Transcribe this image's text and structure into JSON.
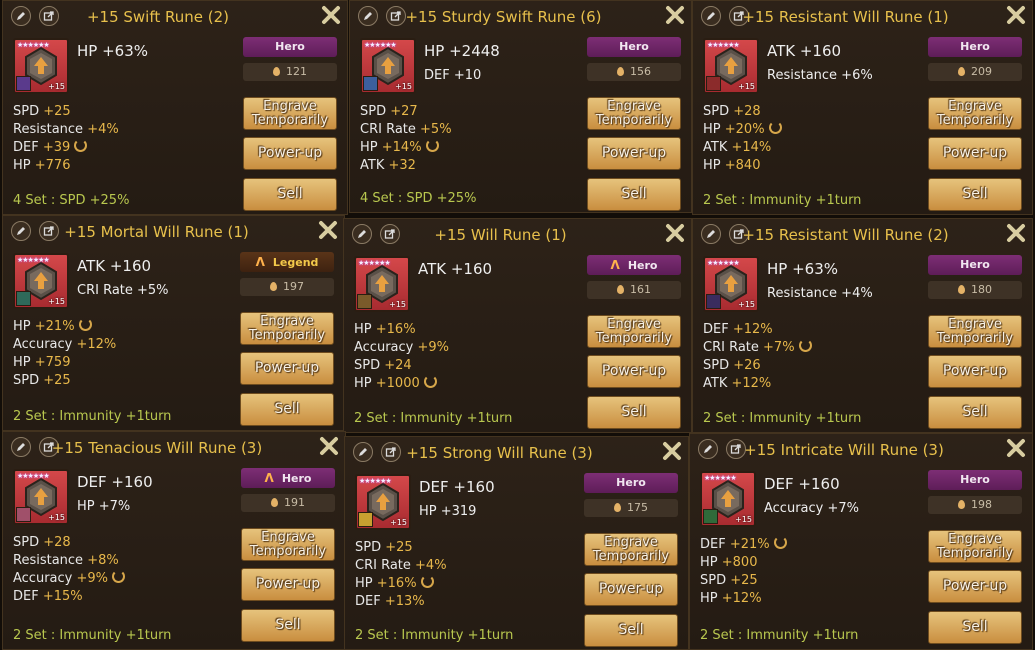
{
  "colors": {
    "accent": "#e7c04c",
    "hero": "#7d2e75",
    "legend": "#f2c94a",
    "set_text": "#b9c84f",
    "value": "#e8b84b"
  },
  "runes": [
    {
      "title": "+15 Swift Rune (2)",
      "stars": "★★★★★★",
      "level": "+15",
      "main": "HP +63%",
      "innate": "",
      "grade": "Hero",
      "grade_mark": "",
      "price": "121",
      "subs": [
        {
          "name": "SPD",
          "val": "+25",
          "grind": false
        },
        {
          "name": "Resistance",
          "val": "+4%",
          "grind": false
        },
        {
          "name": "DEF",
          "val": "+39",
          "grind": true
        },
        {
          "name": "HP",
          "val": "+776",
          "grind": false
        }
      ],
      "set": "4 Set : SPD +25%",
      "engrave": "Engrave Temporarily",
      "power": "Power-up",
      "sell": "Sell",
      "icon": "slot-2-rune-icon"
    },
    {
      "title": "+15 Sturdy Swift Rune (6)",
      "stars": "★★★★★★",
      "level": "+15",
      "main": "HP +2448",
      "innate": "DEF +10",
      "grade": "Hero",
      "grade_mark": "",
      "price": "156",
      "subs": [
        {
          "name": "SPD",
          "val": "+27",
          "grind": false
        },
        {
          "name": "CRI Rate",
          "val": "+5%",
          "grind": false
        },
        {
          "name": "HP",
          "val": "+14%",
          "grind": true
        },
        {
          "name": "ATK",
          "val": "+32",
          "grind": false
        }
      ],
      "set": "4 Set : SPD +25%",
      "engrave": "Engrave Temporarily",
      "power": "Power-up",
      "sell": "Sell",
      "icon": "slot-6-rune-icon"
    },
    {
      "title": "+15 Resistant Will Rune (1)",
      "stars": "★★★★★★",
      "level": "+15",
      "main": "ATK +160",
      "innate": "Resistance +6%",
      "grade": "Hero",
      "grade_mark": "",
      "price": "209",
      "subs": [
        {
          "name": "SPD",
          "val": "+28",
          "grind": false
        },
        {
          "name": "HP",
          "val": "+20%",
          "grind": true
        },
        {
          "name": "ATK",
          "val": "+14%",
          "grind": false
        },
        {
          "name": "HP",
          "val": "+840",
          "grind": false
        }
      ],
      "set": "2 Set : Immunity +1turn",
      "engrave": "Engrave Temporarily",
      "power": "Power-up",
      "sell": "Sell",
      "icon": "slot-1-rune-icon"
    },
    {
      "title": "+15 Mortal Will Rune (1)",
      "stars": "★★★★★★",
      "level": "+15",
      "main": "ATK +160",
      "innate": "CRI Rate +5%",
      "grade": "Legend",
      "grade_mark": "ᐱ",
      "price": "197",
      "subs": [
        {
          "name": "HP",
          "val": "+21%",
          "grind": true
        },
        {
          "name": "Accuracy",
          "val": "+12%",
          "grind": false
        },
        {
          "name": "HP",
          "val": "+759",
          "grind": false
        },
        {
          "name": "SPD",
          "val": "+25",
          "grind": false
        }
      ],
      "set": "2 Set : Immunity +1turn",
      "engrave": "Engrave Temporarily",
      "power": "Power-up",
      "sell": "Sell",
      "icon": "slot-1-rune-icon"
    },
    {
      "title": "+15 Will Rune (1)",
      "stars": "★★★★★★",
      "level": "+15",
      "main": "ATK +160",
      "innate": "",
      "grade": "Hero",
      "grade_mark": "ᐱ",
      "price": "161",
      "subs": [
        {
          "name": "HP",
          "val": "+16%",
          "grind": false
        },
        {
          "name": "Accuracy",
          "val": "+9%",
          "grind": false
        },
        {
          "name": "SPD",
          "val": "+24",
          "grind": false
        },
        {
          "name": "HP",
          "val": "+1000",
          "grind": true
        }
      ],
      "set": "2 Set : Immunity +1turn",
      "engrave": "Engrave Temporarily",
      "power": "Power-up",
      "sell": "Sell",
      "icon": "slot-1-rune-icon"
    },
    {
      "title": "+15 Resistant Will Rune (2)",
      "stars": "★★★★★★",
      "level": "+15",
      "main": "HP +63%",
      "innate": "Resistance +4%",
      "grade": "Hero",
      "grade_mark": "",
      "price": "180",
      "subs": [
        {
          "name": "DEF",
          "val": "+12%",
          "grind": false
        },
        {
          "name": "CRI Rate",
          "val": "+7%",
          "grind": true
        },
        {
          "name": "SPD",
          "val": "+26",
          "grind": false
        },
        {
          "name": "ATK",
          "val": "+12%",
          "grind": false
        }
      ],
      "set": "2 Set : Immunity +1turn",
      "engrave": "Engrave Temporarily",
      "power": "Power-up",
      "sell": "Sell",
      "icon": "slot-2-rune-icon"
    },
    {
      "title": "+15 Tenacious Will Rune (3)",
      "stars": "★★★★★★",
      "level": "+15",
      "main": "DEF +160",
      "innate": "HP +7%",
      "grade": "Hero",
      "grade_mark": "ᐱ",
      "price": "191",
      "subs": [
        {
          "name": "SPD",
          "val": "+28",
          "grind": false
        },
        {
          "name": "Resistance",
          "val": "+8%",
          "grind": false
        },
        {
          "name": "Accuracy",
          "val": "+9%",
          "grind": true
        },
        {
          "name": "DEF",
          "val": "+15%",
          "grind": false
        }
      ],
      "set": "2 Set : Immunity +1turn",
      "engrave": "Engrave Temporarily",
      "power": "Power-up",
      "sell": "Sell",
      "icon": "slot-3-rune-icon"
    },
    {
      "title": "+15 Strong Will Rune (3)",
      "stars": "★★★★★★",
      "level": "+15",
      "main": "DEF +160",
      "innate": "HP +319",
      "grade": "Hero",
      "grade_mark": "",
      "price": "175",
      "subs": [
        {
          "name": "SPD",
          "val": "+25",
          "grind": false
        },
        {
          "name": "CRI Rate",
          "val": "+4%",
          "grind": false
        },
        {
          "name": "HP",
          "val": "+16%",
          "grind": true
        },
        {
          "name": "DEF",
          "val": "+13%",
          "grind": false
        }
      ],
      "set": "2 Set : Immunity +1turn",
      "engrave": "Engrave Temporarily",
      "power": "Power-up",
      "sell": "Sell",
      "icon": "slot-3-rune-icon"
    },
    {
      "title": "+15 Intricate Will Rune (3)",
      "stars": "★★★★★★",
      "level": "+15",
      "main": "DEF +160",
      "innate": "Accuracy +7%",
      "grade": "Hero",
      "grade_mark": "",
      "price": "198",
      "subs": [
        {
          "name": "DEF",
          "val": "+21%",
          "grind": true
        },
        {
          "name": "HP",
          "val": "+800",
          "grind": false
        },
        {
          "name": "SPD",
          "val": "+25",
          "grind": false
        },
        {
          "name": "HP",
          "val": "+12%",
          "grind": false
        }
      ],
      "set": "2 Set : Immunity +1turn",
      "engrave": "Engrave Temporarily",
      "power": "Power-up",
      "sell": "Sell",
      "icon": "slot-3-rune-icon"
    }
  ]
}
